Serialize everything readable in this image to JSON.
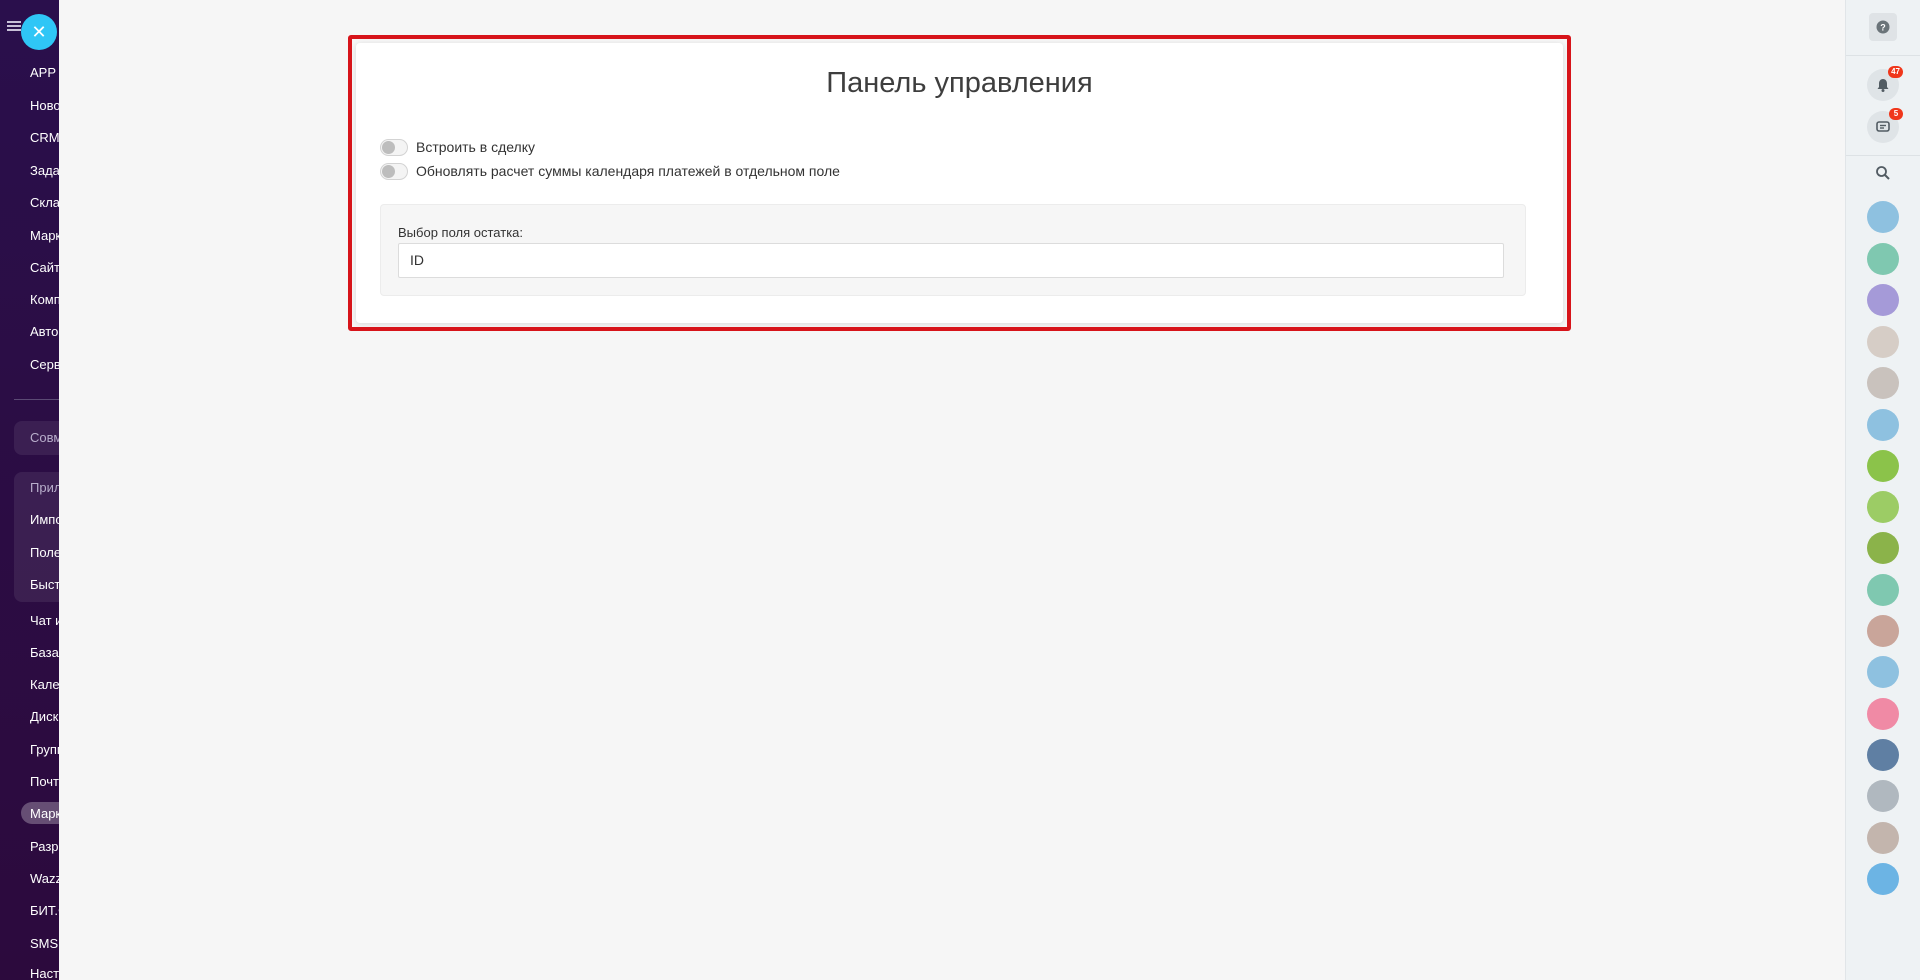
{
  "left_sidebar": {
    "menu_items": [
      {
        "label": "APP",
        "top": 0
      },
      {
        "label": "Новости"
      },
      {
        "label": "CRM"
      },
      {
        "label": "Задачи"
      },
      {
        "label": "Склад"
      },
      {
        "label": "Маркетинг"
      },
      {
        "label": "Сайты"
      },
      {
        "label": "Компания"
      },
      {
        "label": "Автоматизация"
      },
      {
        "label": "Сервисы"
      }
    ],
    "group_items": [
      {
        "label": "Совместная работа"
      },
      {
        "label": "Приложения"
      },
      {
        "label": "Импорт"
      },
      {
        "label": "Полезное"
      },
      {
        "label": "Быстрый старт"
      }
    ],
    "lower_items": [
      {
        "label": "Чат и звонки"
      },
      {
        "label": "База знаний"
      },
      {
        "label": "Календарь"
      },
      {
        "label": "Диск"
      },
      {
        "label": "Группы"
      },
      {
        "label": "Почта"
      },
      {
        "label": "Маркет"
      },
      {
        "label": "Разработчикам"
      },
      {
        "label": "Wazzup"
      },
      {
        "label": "БИТ.Финансы"
      },
      {
        "label": "SMS.ru"
      },
      {
        "label": "Настройки"
      }
    ]
  },
  "panel": {
    "title": "Панель управления",
    "toggles": [
      {
        "label": "Встроить в сделку",
        "on": false
      },
      {
        "label": "Обновлять расчет суммы календаря платежей в отдельном поле",
        "on": false
      }
    ],
    "field": {
      "label": "Выбор поля остатка:",
      "value": "ID"
    }
  },
  "right_sidebar": {
    "notifications_badge": "47",
    "chat_badge": "5"
  },
  "colors": {
    "accent": "#2fc6f6",
    "highlight": "#d7141a",
    "sidebar_bg": "#2a0f4c",
    "badge": "#f0371b"
  }
}
